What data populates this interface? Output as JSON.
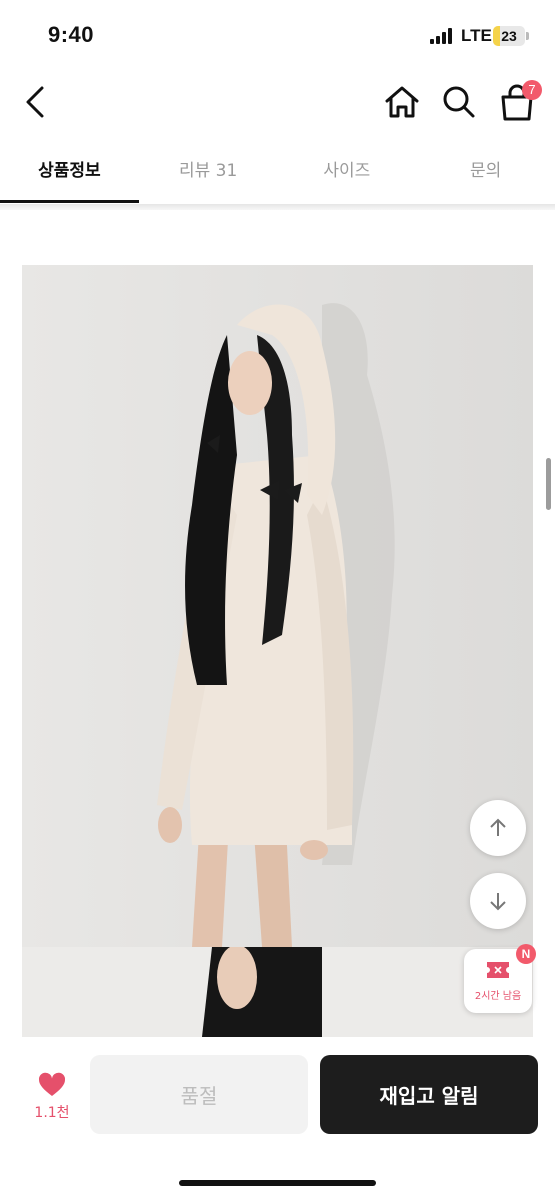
{
  "status_bar": {
    "time": "9:40",
    "network": "LTE",
    "battery_level": "23",
    "battery_fraction": 0.23,
    "battery_color": "#f5d34a"
  },
  "header": {
    "back_icon": "chevron-left-icon",
    "home_icon": "home-icon",
    "search_icon": "search-icon",
    "cart_icon": "shopping-bag-icon",
    "cart_badge": "7",
    "badge_color": "#f25a6b"
  },
  "tabs": [
    {
      "label": "상품정보",
      "active": true
    },
    {
      "label": "리뷰 31",
      "active": false
    },
    {
      "label": "사이즈",
      "active": false
    },
    {
      "label": "문의",
      "active": false
    }
  ],
  "floating": {
    "up_icon": "arrow-up-icon",
    "down_icon": "arrow-down-icon",
    "coupon_badge": "N",
    "coupon_text": "2시간 남음",
    "coupon_icon": "coupon-ticket-icon"
  },
  "bottom_bar": {
    "like_icon": "heart-icon",
    "like_count": "1.1천",
    "soldout_label": "품절",
    "restock_label": "재입고 알림",
    "accent_color": "#e5506b"
  }
}
